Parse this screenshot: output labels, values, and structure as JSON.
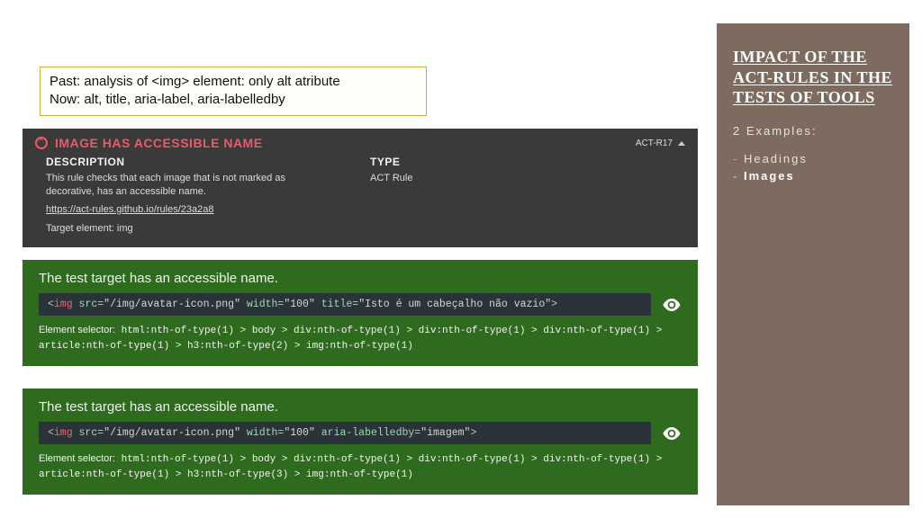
{
  "sidebar": {
    "title": "IMPACT OF THE ACT-RULES IN THE TESTS OF TOOLS",
    "sub": "2 Examples:",
    "items": [
      {
        "label": "Headings",
        "active": false
      },
      {
        "label": "Images",
        "active": true
      }
    ]
  },
  "note": {
    "line1": "Past: analysis of <img> element: only alt atribute",
    "line2": "Now: alt, title, aria-label, aria-labelledby"
  },
  "rule": {
    "title": "IMAGE HAS ACCESSIBLE NAME",
    "code": "ACT-R17",
    "desc_heading": "DESCRIPTION",
    "desc_text": "This rule checks that each image that is not marked as decorative, has an accessible name.",
    "link": "https://act-rules.github.io/rules/23a2a8",
    "target_label": "Target element:",
    "target_value": "img",
    "type_heading": "TYPE",
    "type_value": "ACT Rule"
  },
  "tests": [
    {
      "message": "The test target has an accessible name.",
      "code_tag": "img",
      "code_attrs": [
        {
          "name": "src",
          "value": "/img/avatar-icon.png"
        },
        {
          "name": "width",
          "value": "100"
        },
        {
          "name": "title",
          "value": "Isto é um cabeçalho não vazio"
        }
      ],
      "selector_label": "Element selector:",
      "selector": "html:nth-of-type(1) > body > div:nth-of-type(1) > div:nth-of-type(1) > div:nth-of-type(1) > article:nth-of-type(1) > h3:nth-of-type(2) > img:nth-of-type(1)"
    },
    {
      "message": "The test target has an accessible name.",
      "code_tag": "img",
      "code_attrs": [
        {
          "name": "src",
          "value": "/img/avatar-icon.png"
        },
        {
          "name": "width",
          "value": "100"
        },
        {
          "name": "aria-labelledby",
          "value": "imagem"
        }
      ],
      "selector_label": "Element selector:",
      "selector": "html:nth-of-type(1) > body > div:nth-of-type(1) > div:nth-of-type(1) > div:nth-of-type(1) > article:nth-of-type(1) > h3:nth-of-type(3) > img:nth-of-type(1)"
    }
  ]
}
